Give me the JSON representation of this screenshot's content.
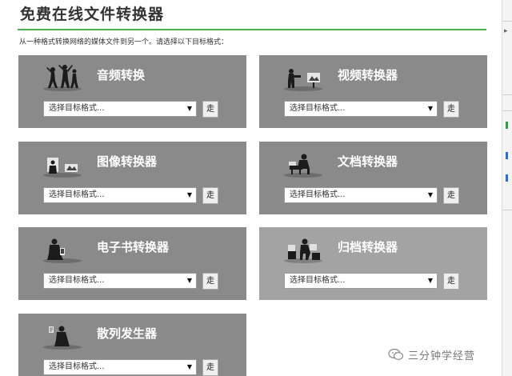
{
  "page": {
    "title": "免费在线文件转换器",
    "intro": "从一种格式转换网络的媒体文件到另一个。请选择以下目标格式："
  },
  "converters": [
    {
      "title": "音频转换",
      "icon": "audio-dancers-icon",
      "select_value": "选择目标格式...",
      "button_label": "走"
    },
    {
      "title": "视频转换器",
      "icon": "video-camera-icon",
      "select_value": "选择目标格式...",
      "button_label": "走"
    },
    {
      "title": "图像转换器",
      "icon": "image-photographer-icon",
      "select_value": "选择目标格式...",
      "button_label": "走"
    },
    {
      "title": "文档转换器",
      "icon": "document-typist-icon",
      "select_value": "选择目标格式...",
      "button_label": "走"
    },
    {
      "title": "电子书转换器",
      "icon": "ebook-reader-icon",
      "select_value": "选择目标格式...",
      "button_label": "走"
    },
    {
      "title": "归档转换器",
      "icon": "archive-boxes-icon",
      "select_value": "选择目标格式...",
      "button_label": "走"
    },
    {
      "title": "散列发生器",
      "icon": "hash-reader-icon",
      "select_value": "选择目标格式...",
      "button_label": "走"
    }
  ],
  "watermark": {
    "text": "三分钟学经营",
    "icon": "wechat-icon"
  },
  "colors": {
    "card": "#8a8a8a",
    "card_archive": "#a3a3a3",
    "accent": "#4caf50"
  }
}
